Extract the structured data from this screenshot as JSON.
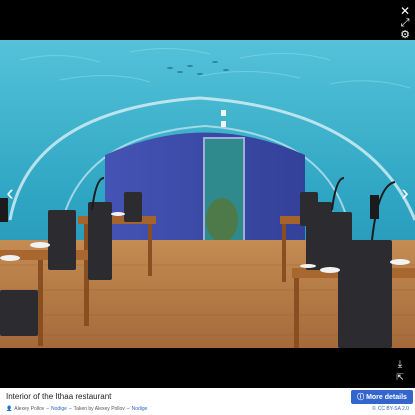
{
  "viewer": {
    "close_icon": "close-icon",
    "fullscreen_icon": "expand-icon",
    "settings_icon": "gear-icon",
    "prev_icon": "chevron-left-icon",
    "next_icon": "chevron-right-icon",
    "download_icon": "download-icon",
    "open_icon": "external-link-icon"
  },
  "caption": {
    "title": "Interior of the Ithaa restaurant",
    "details_label": "More details",
    "author": "Alexey Pollov",
    "author_link": "Nodige",
    "taken_by_prefix": "Taken by Alexey Pollov",
    "taken_by_link": "Nodige",
    "separator": "–",
    "license": "CC BY-SA 2.0"
  },
  "colors": {
    "water": "#2fa6c4",
    "wall": "#3b4aa8",
    "floor": "#b57a45",
    "accent": "#3366cc"
  }
}
